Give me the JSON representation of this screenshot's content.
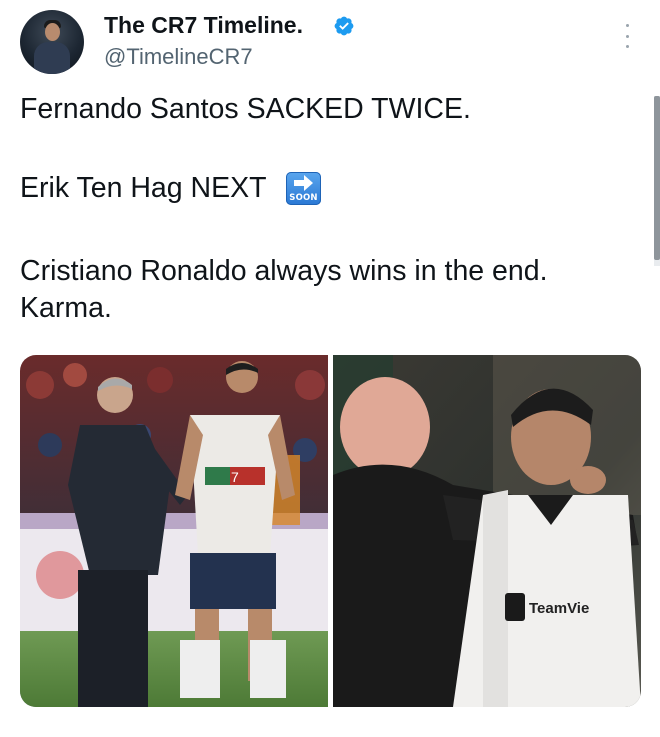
{
  "author": {
    "display_name": "The CR7 Timeline.",
    "handle": "@TimelineCR7",
    "verified": true,
    "avatar_icon": "profile-photo"
  },
  "tweet": {
    "lines": [
      "Fernando Santos SACKED TWICE.",
      "Erik Ten Hag NEXT",
      "Cristiano Ronaldo always wins in the end.",
      "Karma."
    ],
    "emoji": {
      "name": "soon-arrow-emoji",
      "label": "SOON"
    }
  },
  "media": {
    "left": {
      "description_icon": "photo-santos-ronaldo",
      "jersey_number": "7"
    },
    "right": {
      "description_icon": "photo-tenhag-ronaldo",
      "sponsor": "TeamVie"
    }
  },
  "colors": {
    "verified": "#1d9bf0",
    "handle": "#536471",
    "text": "#0f1419"
  },
  "menu": {
    "icon": "more-vertical-icon"
  }
}
